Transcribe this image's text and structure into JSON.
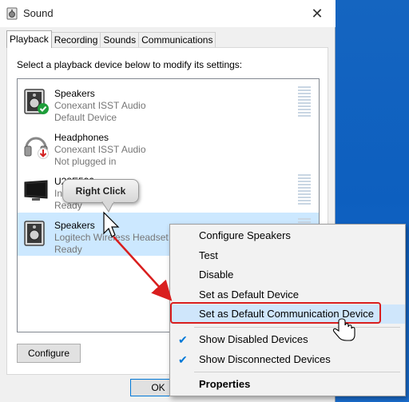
{
  "window": {
    "title": "Sound",
    "close_icon": "close-icon"
  },
  "tabs": [
    {
      "label": "Playback",
      "active": true
    },
    {
      "label": "Recording",
      "active": false
    },
    {
      "label": "Sounds",
      "active": false
    },
    {
      "label": "Communications",
      "active": false
    }
  ],
  "instruction": "Select a playback device below to modify its settings:",
  "devices": [
    {
      "name": "Speakers",
      "line1": "Conexant ISST Audio",
      "line2": "Default Device",
      "icon": "speaker-icon",
      "status": "default-check"
    },
    {
      "name": "Headphones",
      "line1": "Conexant ISST Audio",
      "line2": "Not plugged in",
      "icon": "headphones-icon",
      "status": "unplugged"
    },
    {
      "name": "U28E590",
      "line1": "In",
      "line2": "Ready",
      "icon": "monitor-icon"
    },
    {
      "name": "Speakers",
      "line1": "Logitech Wireless Headset",
      "line2": "Ready",
      "icon": "speaker-icon",
      "selected": true
    }
  ],
  "buttons": {
    "configure": "Configure",
    "ok": "OK"
  },
  "callout": {
    "label": "Right Click"
  },
  "context_menu": {
    "items": [
      {
        "label": "Configure Speakers"
      },
      {
        "label": "Test"
      },
      {
        "label": "Disable"
      },
      {
        "label": "Set as Default Device"
      },
      {
        "label": "Set as Default Communication Device",
        "highlighted": true
      },
      {
        "label": "Show Disabled Devices",
        "checked": true
      },
      {
        "label": "Show Disconnected Devices",
        "checked": true
      },
      {
        "label": "Properties",
        "bold": true
      }
    ]
  },
  "colors": {
    "accent": "#0078d7",
    "selection": "#cce8ff",
    "annotation_red": "#d91e1e",
    "desktop": "#1565c0"
  }
}
